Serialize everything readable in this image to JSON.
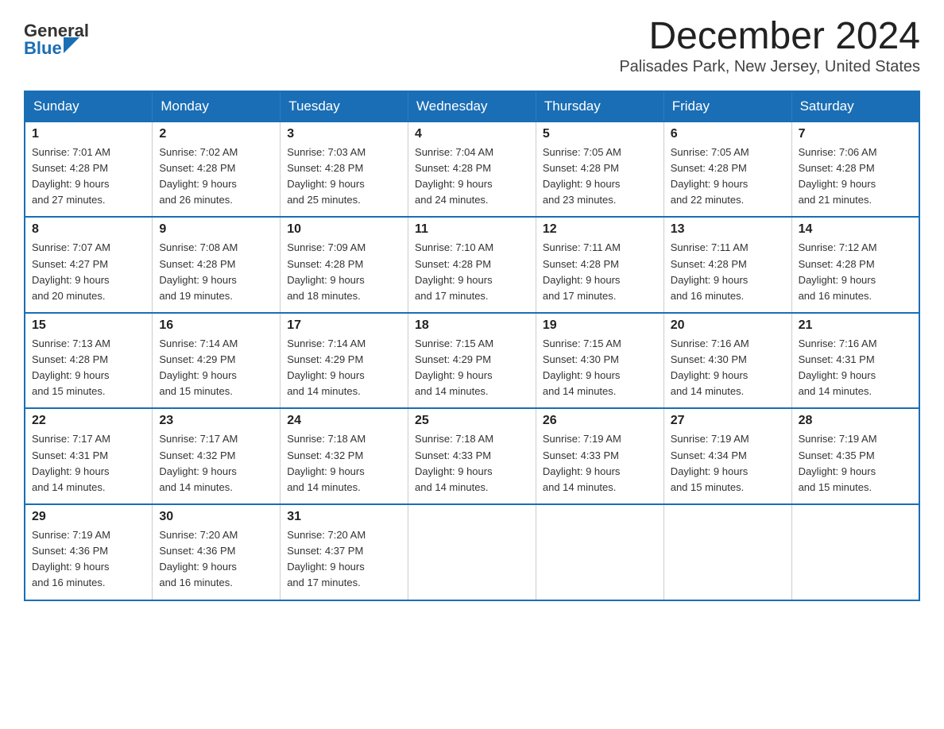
{
  "logo": {
    "general": "General",
    "blue": "Blue"
  },
  "header": {
    "month": "December 2024",
    "location": "Palisades Park, New Jersey, United States"
  },
  "weekdays": [
    "Sunday",
    "Monday",
    "Tuesday",
    "Wednesday",
    "Thursday",
    "Friday",
    "Saturday"
  ],
  "weeks": [
    [
      {
        "day": "1",
        "sunrise": "7:01 AM",
        "sunset": "4:28 PM",
        "daylight": "9 hours and 27 minutes."
      },
      {
        "day": "2",
        "sunrise": "7:02 AM",
        "sunset": "4:28 PM",
        "daylight": "9 hours and 26 minutes."
      },
      {
        "day": "3",
        "sunrise": "7:03 AM",
        "sunset": "4:28 PM",
        "daylight": "9 hours and 25 minutes."
      },
      {
        "day": "4",
        "sunrise": "7:04 AM",
        "sunset": "4:28 PM",
        "daylight": "9 hours and 24 minutes."
      },
      {
        "day": "5",
        "sunrise": "7:05 AM",
        "sunset": "4:28 PM",
        "daylight": "9 hours and 23 minutes."
      },
      {
        "day": "6",
        "sunrise": "7:05 AM",
        "sunset": "4:28 PM",
        "daylight": "9 hours and 22 minutes."
      },
      {
        "day": "7",
        "sunrise": "7:06 AM",
        "sunset": "4:28 PM",
        "daylight": "9 hours and 21 minutes."
      }
    ],
    [
      {
        "day": "8",
        "sunrise": "7:07 AM",
        "sunset": "4:27 PM",
        "daylight": "9 hours and 20 minutes."
      },
      {
        "day": "9",
        "sunrise": "7:08 AM",
        "sunset": "4:28 PM",
        "daylight": "9 hours and 19 minutes."
      },
      {
        "day": "10",
        "sunrise": "7:09 AM",
        "sunset": "4:28 PM",
        "daylight": "9 hours and 18 minutes."
      },
      {
        "day": "11",
        "sunrise": "7:10 AM",
        "sunset": "4:28 PM",
        "daylight": "9 hours and 17 minutes."
      },
      {
        "day": "12",
        "sunrise": "7:11 AM",
        "sunset": "4:28 PM",
        "daylight": "9 hours and 17 minutes."
      },
      {
        "day": "13",
        "sunrise": "7:11 AM",
        "sunset": "4:28 PM",
        "daylight": "9 hours and 16 minutes."
      },
      {
        "day": "14",
        "sunrise": "7:12 AM",
        "sunset": "4:28 PM",
        "daylight": "9 hours and 16 minutes."
      }
    ],
    [
      {
        "day": "15",
        "sunrise": "7:13 AM",
        "sunset": "4:28 PM",
        "daylight": "9 hours and 15 minutes."
      },
      {
        "day": "16",
        "sunrise": "7:14 AM",
        "sunset": "4:29 PM",
        "daylight": "9 hours and 15 minutes."
      },
      {
        "day": "17",
        "sunrise": "7:14 AM",
        "sunset": "4:29 PM",
        "daylight": "9 hours and 14 minutes."
      },
      {
        "day": "18",
        "sunrise": "7:15 AM",
        "sunset": "4:29 PM",
        "daylight": "9 hours and 14 minutes."
      },
      {
        "day": "19",
        "sunrise": "7:15 AM",
        "sunset": "4:30 PM",
        "daylight": "9 hours and 14 minutes."
      },
      {
        "day": "20",
        "sunrise": "7:16 AM",
        "sunset": "4:30 PM",
        "daylight": "9 hours and 14 minutes."
      },
      {
        "day": "21",
        "sunrise": "7:16 AM",
        "sunset": "4:31 PM",
        "daylight": "9 hours and 14 minutes."
      }
    ],
    [
      {
        "day": "22",
        "sunrise": "7:17 AM",
        "sunset": "4:31 PM",
        "daylight": "9 hours and 14 minutes."
      },
      {
        "day": "23",
        "sunrise": "7:17 AM",
        "sunset": "4:32 PM",
        "daylight": "9 hours and 14 minutes."
      },
      {
        "day": "24",
        "sunrise": "7:18 AM",
        "sunset": "4:32 PM",
        "daylight": "9 hours and 14 minutes."
      },
      {
        "day": "25",
        "sunrise": "7:18 AM",
        "sunset": "4:33 PM",
        "daylight": "9 hours and 14 minutes."
      },
      {
        "day": "26",
        "sunrise": "7:19 AM",
        "sunset": "4:33 PM",
        "daylight": "9 hours and 14 minutes."
      },
      {
        "day": "27",
        "sunrise": "7:19 AM",
        "sunset": "4:34 PM",
        "daylight": "9 hours and 15 minutes."
      },
      {
        "day": "28",
        "sunrise": "7:19 AM",
        "sunset": "4:35 PM",
        "daylight": "9 hours and 15 minutes."
      }
    ],
    [
      {
        "day": "29",
        "sunrise": "7:19 AM",
        "sunset": "4:36 PM",
        "daylight": "9 hours and 16 minutes."
      },
      {
        "day": "30",
        "sunrise": "7:20 AM",
        "sunset": "4:36 PM",
        "daylight": "9 hours and 16 minutes."
      },
      {
        "day": "31",
        "sunrise": "7:20 AM",
        "sunset": "4:37 PM",
        "daylight": "9 hours and 17 minutes."
      },
      null,
      null,
      null,
      null
    ]
  ]
}
